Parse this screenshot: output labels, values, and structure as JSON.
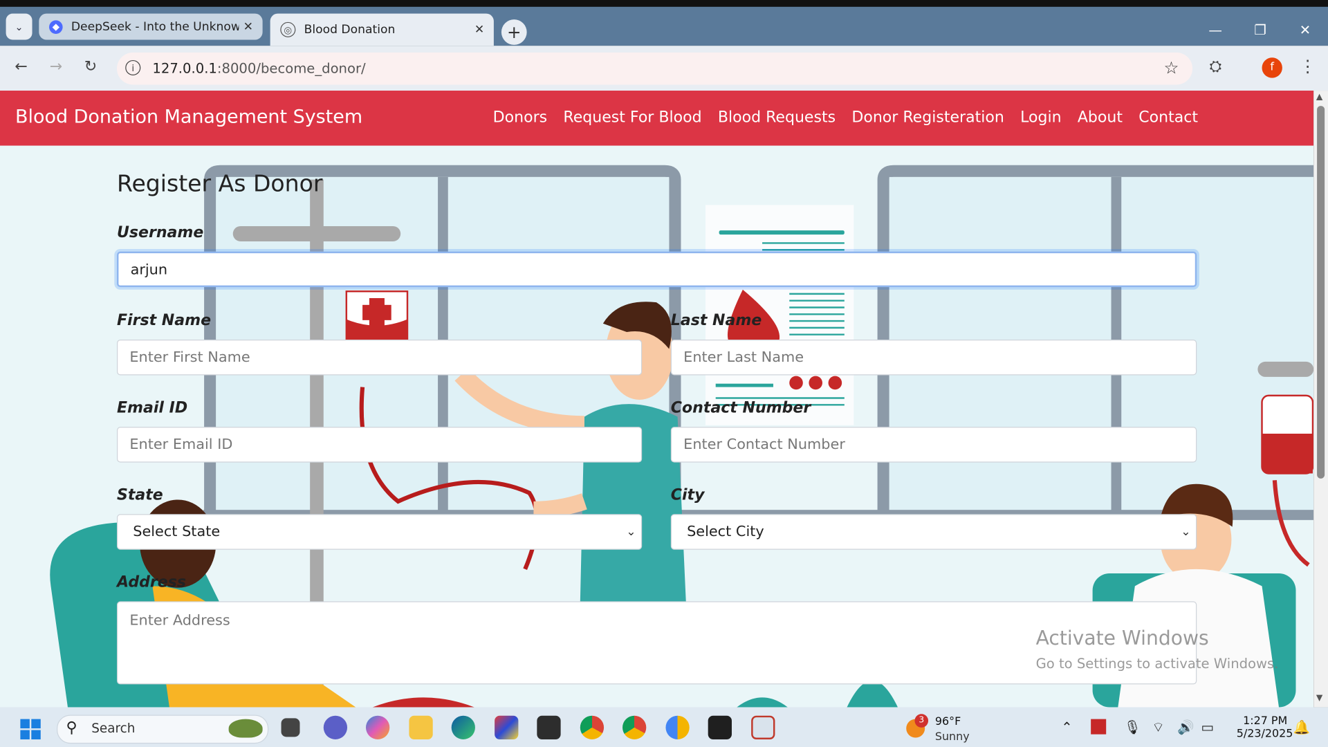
{
  "browser": {
    "tabs": [
      {
        "title": "DeepSeek - Into the Unknown",
        "active": false,
        "icon": "deepseek-whale-icon"
      },
      {
        "title": "Blood Donation",
        "active": true,
        "icon": "globe-icon"
      }
    ],
    "url_host": "127.0.0.1",
    "url_path": ":8000/become_donor/"
  },
  "navbar": {
    "brand": "Blood Donation Management System",
    "links": [
      "Donors",
      "Request For Blood",
      "Blood Requests",
      "Donor Registeration",
      "Login",
      "About",
      "Contact"
    ],
    "color": "#dc3545"
  },
  "form": {
    "title": "Register As Donor",
    "username_label": "Username",
    "username_value": "arjun",
    "first_name_label": "First Name",
    "first_name_placeholder": "Enter First Name",
    "last_name_label": "Last Name",
    "last_name_placeholder": "Enter Last Name",
    "email_label": "Email ID",
    "email_placeholder": "Enter Email ID",
    "contact_label": "Contact Number",
    "contact_placeholder": "Enter Contact Number",
    "state_label": "State",
    "state_value": "Select State",
    "city_label": "City",
    "city_value": "Select City",
    "address_label": "Address",
    "address_placeholder": "Enter Address"
  },
  "watermark": {
    "line1": "Activate Windows",
    "line2": "Go to Settings to activate Windows."
  },
  "taskbar": {
    "search_label": "Search",
    "weather_temp": "96°F",
    "weather_cond": "Sunny",
    "weather_badge": "3",
    "time": "1:27 PM",
    "date": "5/23/2025"
  }
}
